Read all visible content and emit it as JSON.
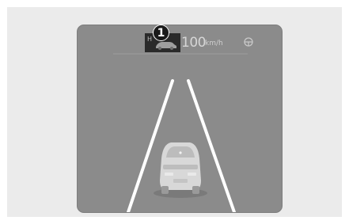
{
  "callout": {
    "number": "1"
  },
  "speed": {
    "value": "100",
    "unit": "km/h"
  },
  "colors": {
    "screen": "#8b8b8b",
    "frame": "#ebebeb",
    "lane": "#ffffff",
    "badge": "#2a2a2a"
  },
  "icons": [
    "vehicle-distance-icon",
    "steering-wheel-icon",
    "car-icon"
  ]
}
